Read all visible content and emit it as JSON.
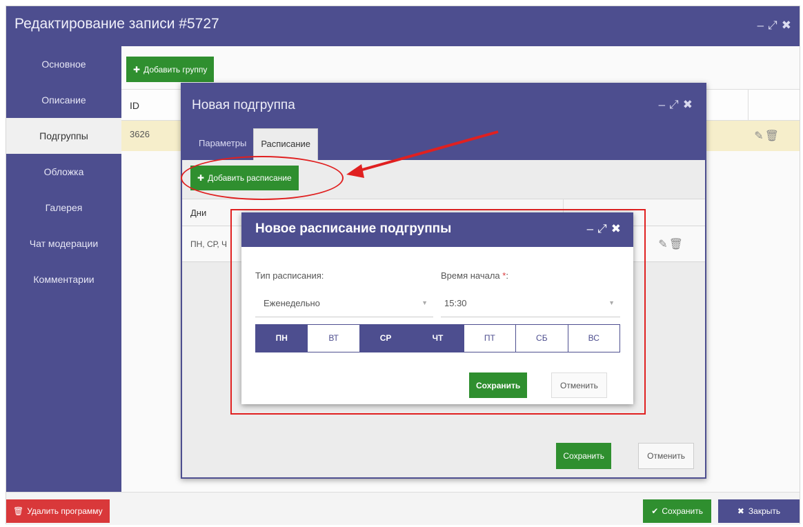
{
  "window": {
    "title": "Редактирование записи #5727",
    "controls": [
      "–",
      "⤢",
      "✖"
    ]
  },
  "sidebar": {
    "items": [
      {
        "label": "Основное"
      },
      {
        "label": "Описание"
      },
      {
        "label": "Подгруппы",
        "active": true
      },
      {
        "label": "Обложка"
      },
      {
        "label": "Галерея"
      },
      {
        "label": "Чат модерации"
      },
      {
        "label": "Комментарии"
      }
    ]
  },
  "content": {
    "add_group_label": "Добавить группу",
    "table": {
      "header_id": "ID",
      "row": {
        "id": "3626"
      }
    }
  },
  "footer": {
    "delete_label": "Удалить программу",
    "save_label": "Сохранить",
    "close_label": "Закрыть"
  },
  "subgroup_dialog": {
    "title": "Новая подгруппа",
    "tabs": [
      {
        "label": "Параметры"
      },
      {
        "label": "Расписание",
        "active": true
      }
    ],
    "add_schedule_label": "Добавить расписание",
    "table_header_days": "Дни",
    "row_days": "ПН, СР, Ч",
    "save_label": "Сохранить",
    "cancel_label": "Отменить"
  },
  "schedule_dialog": {
    "title": "Новое расписание подгруппы",
    "schedule_type_label": "Тип расписания:",
    "schedule_type_value": "Еженедельно",
    "start_time_label": "Время начала ",
    "start_time_required": "*",
    "start_time_colon": ":",
    "start_time_value": "15:30",
    "days": [
      {
        "label": "ПН",
        "selected": true
      },
      {
        "label": "ВТ",
        "selected": false
      },
      {
        "label": "СР",
        "selected": true
      },
      {
        "label": "ЧТ",
        "selected": true
      },
      {
        "label": "ПТ",
        "selected": false
      },
      {
        "label": "СБ",
        "selected": false
      },
      {
        "label": "ВС",
        "selected": false
      }
    ],
    "save_label": "Сохранить",
    "cancel_label": "Отменить"
  },
  "colors": {
    "brand": "#4d4e8f",
    "success": "#2f8f2f",
    "danger": "#d9383a",
    "highlight_row": "#f6eecb",
    "annotation": "#e02020"
  }
}
